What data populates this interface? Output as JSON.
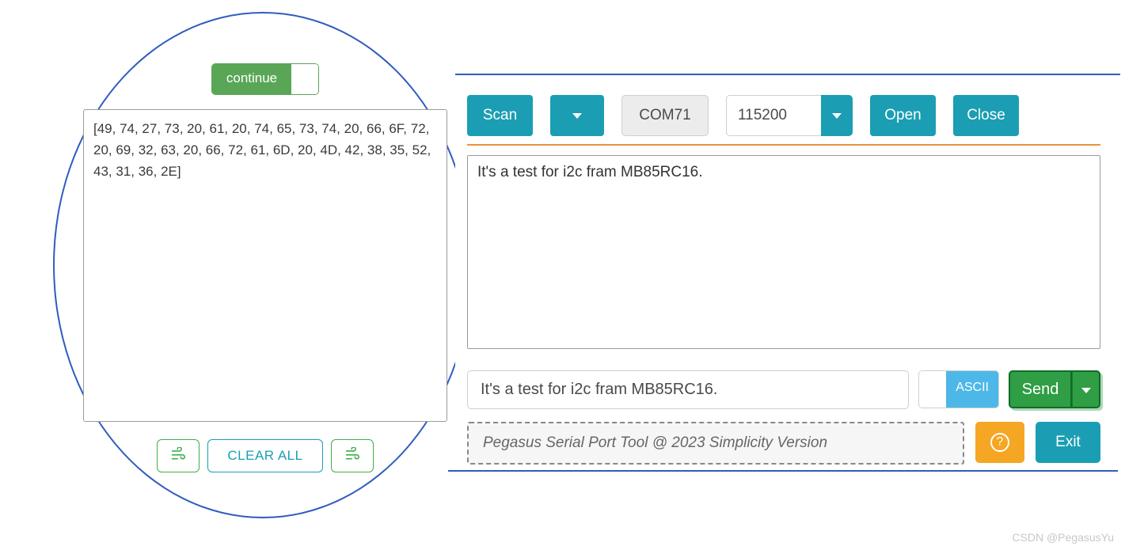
{
  "left": {
    "continue_label": "continue",
    "hex_output": "[49, 74, 27, 73, 20, 61, 20, 74, 65, 73, 74, 20, 66, 6F, 72, 20, 69, 32, 63, 20, 66, 72, 61, 6D, 20, 4D, 42, 38, 35, 52, 43, 31, 36, 2E]",
    "clear_label": "CLEAR ALL"
  },
  "toolbar": {
    "scan": "Scan",
    "port": "COM71",
    "baud": "115200",
    "open": "Open",
    "close": "Close"
  },
  "rx_text": "It's a test for i2c fram MB85RC16.",
  "tx": {
    "value": "It's a test for i2c fram MB85RC16.",
    "mode_label": "ASCII",
    "send_label": "Send"
  },
  "footer": {
    "note": "Pegasus Serial Port Tool @ 2023 Simplicity Version",
    "exit": "Exit"
  },
  "watermark": "CSDN @PegasusYu",
  "colors": {
    "teal": "#1b9eb3",
    "green": "#2f9e44",
    "orange": "#f5a623",
    "separator": "#e9943b",
    "bubble_border": "#2f5cc0"
  }
}
